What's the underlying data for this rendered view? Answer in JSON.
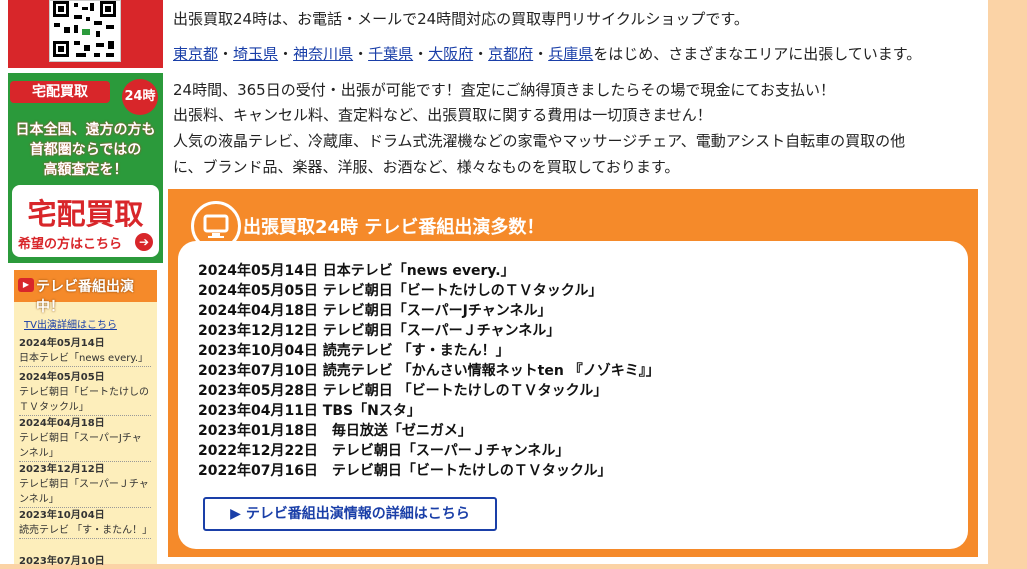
{
  "left": {
    "banner": {
      "head": "宅配買取",
      "badge": "24時",
      "line1": "日本全国、遠方の方も",
      "line2": "首都圏ならではの",
      "line3": "高額査定を！",
      "big": "宅配買取",
      "small": "希望の方はこちら"
    },
    "tv": {
      "header": "テレビ番組出演中！",
      "link": "TV出演詳細はこちら",
      "entries": [
        {
          "date": "2024年05月14日",
          "text": "日本テレビ「news every.」"
        },
        {
          "date": "2024年05月05日",
          "text": "テレビ朝日「ビートたけしのＴＶタックル」"
        },
        {
          "date": "2024年04月18日",
          "text": "テレビ朝日「スーパーJチャンネル」"
        },
        {
          "date": "2023年12月12日",
          "text": "テレビ朝日「スーパーＪチャンネル」"
        },
        {
          "date": "2023年10月04日",
          "text": "読売テレビ 「す・またん！」"
        },
        {
          "date": "2023年07月10日",
          "text": ""
        }
      ]
    }
  },
  "main": {
    "intro": "出張買取24時は、お電話・メールで24時間対応の買取専門リサイクルショップです。",
    "prefectures": [
      "東京都",
      "埼玉県",
      "神奈川県",
      "千葉県",
      "大阪府",
      "京都府",
      "兵庫県"
    ],
    "pref_separator": "・",
    "pref_suffix": "をはじめ、さまざまなエリアに出張しています。",
    "para1": "24時間、365日の受付・出張が可能です！査定にご納得頂きましたらその場で現金にてお支払い！",
    "para2": "出張料、キャンセル料、査定料など、出張買取に関する費用は一切頂きません！",
    "para3": "人気の液晶テレビ、冷蔵庫、ドラム式洗濯機などの家電やマッサージチェア、電動アシスト自転車の買取の他",
    "para4": "に、ブランド品、楽器、洋服、お酒など、様々なものを買取しております。",
    "tv_title": "出張買取24時 テレビ番組出演多数！",
    "tv_rows": [
      "2024年05月14日 日本テレビ「news every.」",
      "2024年05月05日 テレビ朝日「ビートたけしのＴＶタックル」",
      "2024年04月18日 テレビ朝日「スーパーJチャンネル」",
      "2023年12月12日 テレビ朝日「スーパーＪチャンネル」",
      "2023年10月04日 読売テレビ 「す・またん！」",
      "2023年07月10日 読売テレビ 「かんさい情報ネットten 『ノゾキミ』」",
      "2023年05月28日 テレビ朝日 「ビートたけしのＴＶタックル」",
      "2023年04月11日 TBS「Nスタ」",
      "2023年01月18日　毎日放送「ゼニガメ」",
      "2022年12月22日　テレビ朝日「スーパーＪチャンネル」",
      "2022年07月16日　テレビ朝日「ビートたけしのＴＶタックル」"
    ],
    "detail_button": "▶ テレビ番組出演情報の詳細はこちら"
  },
  "colors": {
    "orange": "#f58a2a",
    "red": "#d8262a",
    "green": "#2b9a3b",
    "link": "#1a3fa8"
  }
}
